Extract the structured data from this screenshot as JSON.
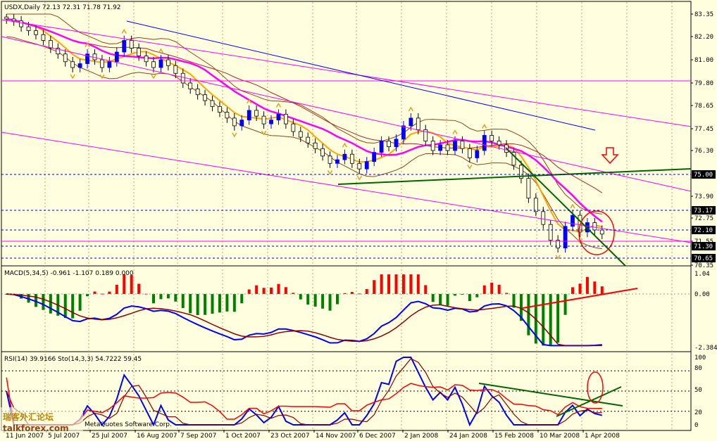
{
  "chart_data": [
    {
      "type": "candlestick",
      "panel": "price",
      "title": "USDX,Daily  72.13 72.31 71.78 71.92",
      "ylim": [
        70.35,
        83.9
      ],
      "y_ticks": [
        "83.35",
        "82.20",
        "81.00",
        "79.80",
        "78.65",
        "77.45",
        "76.30",
        "75.00",
        "73.90",
        "73.17",
        "72.75",
        "72.10",
        "71.55",
        "71.30",
        "70.65",
        "70.35"
      ],
      "highlight_ticks": [
        "75.00",
        "73.17",
        "72.10",
        "71.30",
        "70.65"
      ],
      "close_series": [
        83.1,
        83.0,
        82.7,
        82.5,
        82.3,
        82.0,
        81.6,
        81.3,
        80.9,
        80.6,
        80.8,
        81.3,
        81.0,
        80.6,
        80.9,
        81.4,
        82.0,
        81.6,
        81.2,
        80.9,
        80.6,
        81.0,
        80.7,
        80.3,
        79.8,
        79.5,
        79.2,
        78.9,
        78.6,
        78.3,
        78.0,
        77.6,
        77.9,
        78.4,
        78.1,
        77.7,
        77.9,
        78.2,
        77.7,
        77.3,
        77.0,
        76.7,
        76.4,
        76.0,
        75.6,
        75.8,
        76.1,
        75.6,
        75.3,
        75.7,
        76.2,
        76.8,
        76.5,
        76.9,
        77.6,
        78.0,
        77.4,
        76.8,
        76.3,
        76.6,
        76.3,
        76.8,
        76.4,
        75.9,
        76.3,
        77.1,
        76.8,
        76.6,
        76.2,
        75.5,
        74.8,
        73.8,
        73.1,
        72.4,
        71.6,
        71.2,
        72.3,
        72.9,
        72.0,
        72.5,
        72.1,
        71.9
      ]
    },
    {
      "type": "macd",
      "panel": "macd",
      "title": "MACD(5,34,5) -0.961 -1.107 0.189 0.000",
      "ylim": [
        -2.384,
        1.04
      ],
      "y_ticks": [
        "1.04",
        "0.00",
        "-2.384"
      ]
    },
    {
      "type": "line",
      "panel": "oscillators",
      "title": "RSI(14) 39.9166  Sto(14,3,3) 54.7222 59.45",
      "ylim": [
        0,
        100
      ],
      "y_ticks": [
        "100",
        "80",
        "50",
        "20",
        "0"
      ]
    }
  ],
  "x_axis": [
    "11 Jun 2007",
    "5 Jul 2007",
    "25 Jul 2007",
    "16 Aug 2007",
    "7 Sep 2007",
    "1 Oct 2007",
    "23 Oct 2007",
    "14 Nov 2007",
    "6 Dec 2007",
    "2 Jan 2008",
    "24 Jan 2008",
    "15 Feb 2008",
    "10 Mar 2008",
    "1 Apr 2008"
  ],
  "watermark": {
    "cn": "瑞客外汇论坛",
    "site": "talkforex.com",
    "copyright": "MetaQuotes Software Corp."
  },
  "colors": {
    "bg": "#FFFFE0",
    "bull": "#0000FF",
    "ma_orange": "#FFA500",
    "magenta": "#FF00FF",
    "ma_blue": "#0000FF",
    "trend_green": "#008000",
    "alert_red": "#FF0000",
    "macd_up": "#FF0000",
    "macd_down": "#008000"
  }
}
